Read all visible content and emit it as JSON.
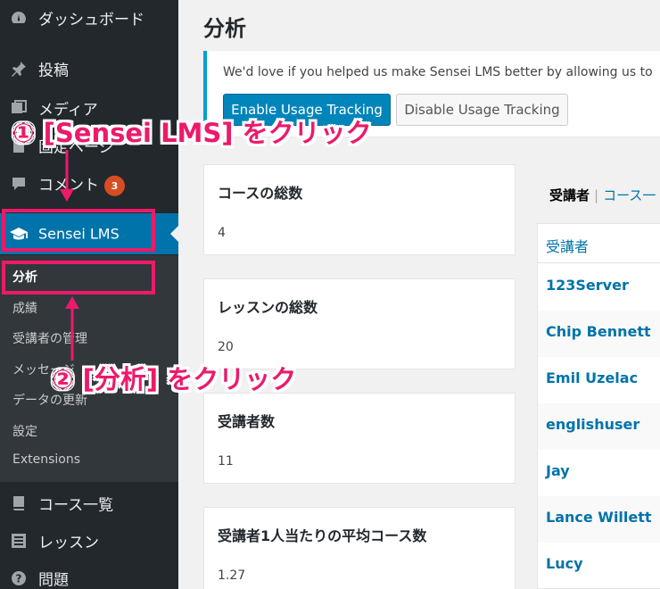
{
  "sidebar": {
    "items": [
      {
        "label": "ダッシュボード",
        "icon": "dashboard-icon"
      },
      {
        "label": "投稿",
        "icon": "pin-icon"
      },
      {
        "label": "メディア",
        "icon": "media-icon"
      },
      {
        "label": "固定ページ",
        "icon": "page-icon"
      },
      {
        "label": "コメント",
        "icon": "comment-icon",
        "badge": "3"
      },
      {
        "label": "Sensei LMS",
        "icon": "graduation-cap-icon"
      }
    ],
    "submenu": [
      "分析",
      "成績",
      "受講者の管理",
      "メッセージ",
      "データの更新",
      "設定",
      "Extensions"
    ],
    "bottom_items": [
      {
        "label": "コース一覧",
        "icon": "book-icon"
      },
      {
        "label": "レッスン",
        "icon": "list-icon"
      },
      {
        "label": "問題",
        "icon": "question-icon"
      }
    ]
  },
  "main": {
    "title": "分析",
    "notice": {
      "text": "We'd love if you helped us make Sensei LMS better by allowing us to",
      "enable_label": "Enable Usage Tracking",
      "disable_label": "Disable Usage Tracking"
    },
    "stats": [
      {
        "title": "コースの総数",
        "value": "4"
      },
      {
        "title": "レッスンの総数",
        "value": "20"
      },
      {
        "title": "受講者数",
        "value": "11"
      },
      {
        "title": "受講者1人当たりの平均コース数",
        "value": "1.27"
      }
    ],
    "tabs": {
      "current": "受講者",
      "separator": "|",
      "other": "コース一"
    },
    "learners_header": "受講者",
    "learners": [
      "123Server",
      "Chip Bennett",
      "Emil Uzelac",
      "englishuser",
      "Jay",
      "Lance Willett",
      "Lucy"
    ]
  },
  "annotations": {
    "step1": "① [Sensei LMS] をクリック",
    "step2": "② [分析] をクリック",
    "color": "#ec1a6a"
  }
}
